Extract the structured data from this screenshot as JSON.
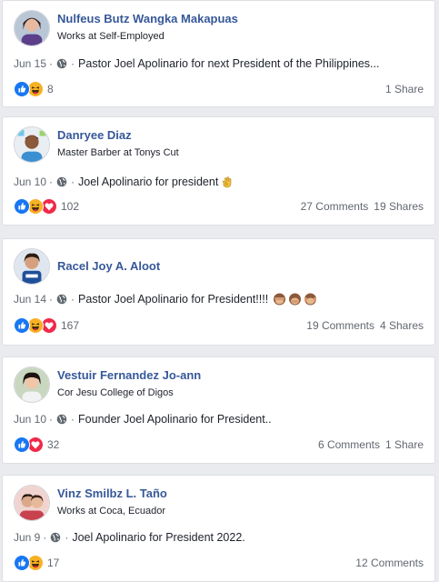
{
  "posts": [
    {
      "name": "Nulfeus Butz Wangka Makapuas",
      "subtitle": "Works at Self-Employed",
      "date": "Jun 15",
      "text": "Pastor Joel Apolinario for next President of the Philippines...",
      "reaction_count": "8",
      "comments": "",
      "shares": "1 Share",
      "reactions": [
        "like",
        "haha"
      ]
    },
    {
      "name": "Danryee Diaz",
      "subtitle": "Master Barber at Tonys Cut",
      "date": "Jun 10",
      "text": "Joel Apolinario for president",
      "reaction_count": "102",
      "comments": "27 Comments",
      "shares": "19 Shares",
      "reactions": [
        "like",
        "haha",
        "love"
      ]
    },
    {
      "name": "Racel Joy A. Aloot",
      "subtitle": "",
      "date": "Jun 14",
      "text": "Pastor Joel Apolinario for President!!!!",
      "reaction_count": "167",
      "comments": "19 Comments",
      "shares": "4 Shares",
      "reactions": [
        "like",
        "haha",
        "love"
      ]
    },
    {
      "name": "Vestuir Fernandez Jo-ann",
      "subtitle": "Cor Jesu College of Digos",
      "date": "Jun 10",
      "text": "Founder Joel Apolinario for President..",
      "reaction_count": "32",
      "comments": "6 Comments",
      "shares": "1 Share",
      "reactions": [
        "like",
        "love"
      ]
    },
    {
      "name": "Vinz Smilbz L. Taño",
      "subtitle": "Works at Coca, Ecuador",
      "date": "Jun 9",
      "text": "Joel Apolinario for President 2022.",
      "reaction_count": "17",
      "comments": "12 Comments",
      "shares": "",
      "reactions": [
        "like",
        "haha"
      ]
    }
  ],
  "separator": "·",
  "colors": {
    "name_link": "#365899",
    "like": "#1877f2",
    "haha": "#f7b125",
    "love": "#f0284a",
    "background": "#e9ebee"
  },
  "icons": {
    "privacy": "globe-icon",
    "post2_emoji": "ok-hand-emoji",
    "post3_emoji": "see-no-evil-monkey-emoji"
  }
}
